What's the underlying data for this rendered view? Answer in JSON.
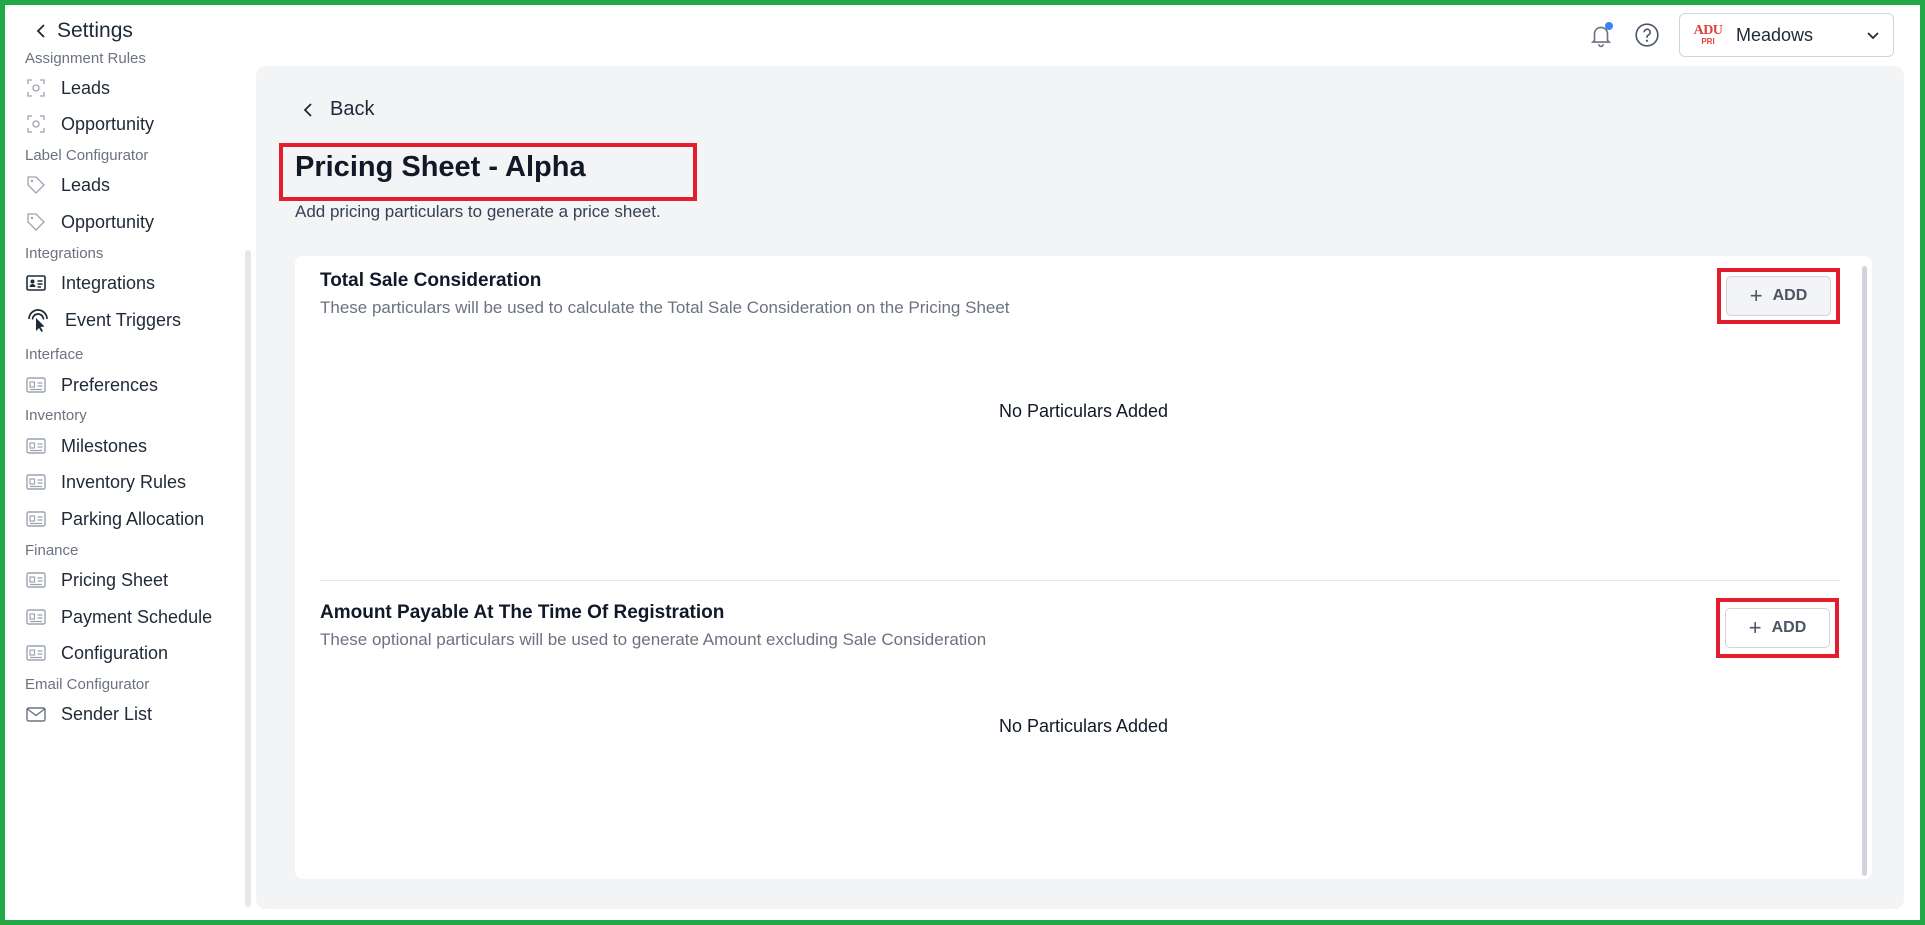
{
  "header": {
    "back_label": "Settings",
    "project_logo_line1": "ADU",
    "project_logo_line2": "PRI",
    "project_name": "Meadows",
    "notification_color": "#3b82f6"
  },
  "sidebar": {
    "sections": [
      {
        "label": "Assignment Rules",
        "items": [
          {
            "label": "Leads",
            "icon": "target-icon"
          },
          {
            "label": "Opportunity",
            "icon": "target-icon"
          }
        ]
      },
      {
        "label": "Label Configurator",
        "items": [
          {
            "label": "Leads",
            "icon": "tag-icon"
          },
          {
            "label": "Opportunity",
            "icon": "tag-icon"
          }
        ]
      },
      {
        "label": "Integrations",
        "items": [
          {
            "label": "Integrations",
            "icon": "id-card-icon"
          },
          {
            "label": "Event Triggers",
            "icon": "tap-icon"
          }
        ]
      },
      {
        "label": "Interface",
        "items": [
          {
            "label": "Preferences",
            "icon": "id-card-icon"
          }
        ]
      },
      {
        "label": "Inventory",
        "items": [
          {
            "label": "Milestones",
            "icon": "id-card-icon"
          },
          {
            "label": "Inventory Rules",
            "icon": "id-card-icon"
          },
          {
            "label": "Parking Allocation",
            "icon": "id-card-icon"
          }
        ]
      },
      {
        "label": "Finance",
        "items": [
          {
            "label": "Pricing Sheet",
            "icon": "id-card-icon"
          },
          {
            "label": "Payment Schedule",
            "icon": "id-card-icon"
          },
          {
            "label": "Configuration",
            "icon": "id-card-icon"
          }
        ]
      },
      {
        "label": "Email Configurator",
        "items": [
          {
            "label": "Sender List",
            "icon": "mail-icon"
          }
        ]
      }
    ]
  },
  "main": {
    "back_label": "Back",
    "title": "Pricing Sheet - Alpha",
    "subtitle": "Add pricing particulars to generate a price sheet.",
    "sections": [
      {
        "title": "Total Sale Consideration",
        "description": "These particulars will be used to calculate the Total Sale Consideration on the Pricing Sheet",
        "add_label": "ADD",
        "empty_text": "No Particulars Added"
      },
      {
        "title": "Amount Payable At The Time Of Registration",
        "description": "These optional particulars will be used to generate Amount excluding Sale Consideration",
        "add_label": "ADD",
        "empty_text": "No Particulars Added"
      }
    ]
  },
  "colors": {
    "highlight": "#e11d2e",
    "frame": "#22a846",
    "content_bg": "#f3f4f6"
  }
}
